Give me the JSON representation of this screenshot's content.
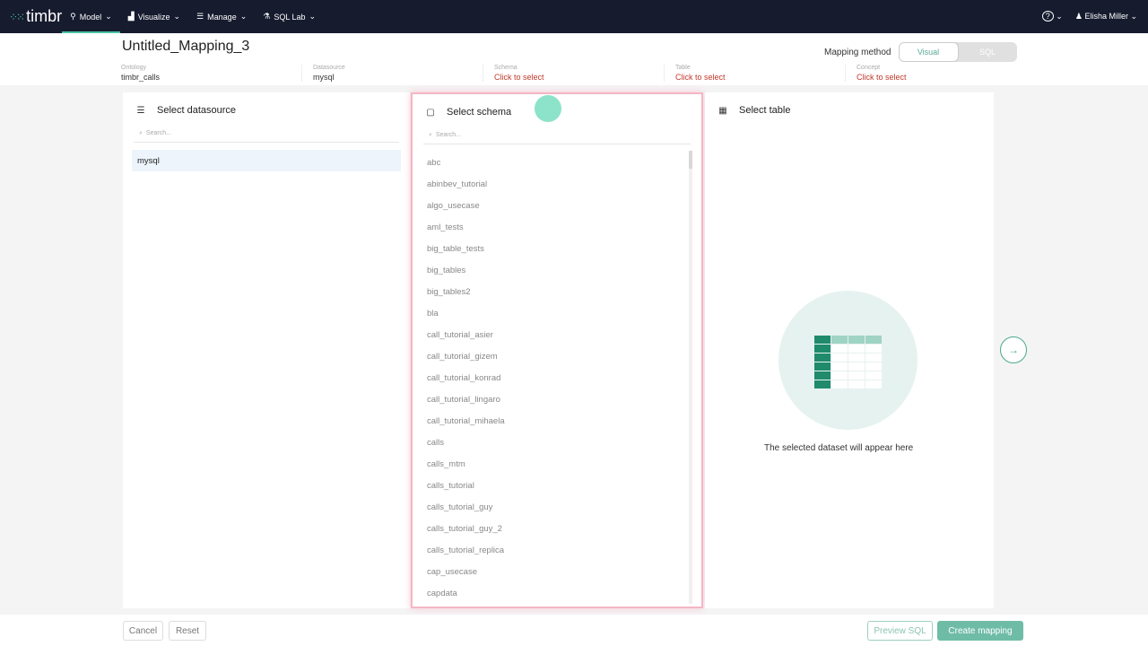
{
  "nav": {
    "logo": "timbr",
    "items": [
      {
        "label": "Model",
        "icon": "bulb-icon"
      },
      {
        "label": "Visualize",
        "icon": "chart-icon"
      },
      {
        "label": "Manage",
        "icon": "database-icon"
      },
      {
        "label": "SQL Lab",
        "icon": "flask-icon"
      }
    ],
    "help": "?",
    "user": "Elisha Miller"
  },
  "header": {
    "title": "Untitled_Mapping_3",
    "mapping_method_label": "Mapping method",
    "methods": [
      "Visual",
      "SQL"
    ],
    "crumbs": [
      {
        "label": "Ontology",
        "value": "timbr_calls"
      },
      {
        "label": "Datasource",
        "value": "mysql"
      },
      {
        "label": "Schema",
        "value": "Click to select"
      },
      {
        "label": "Table",
        "value": "Click to select"
      },
      {
        "label": "Concept",
        "value": "Click to select"
      }
    ]
  },
  "datasource": {
    "title": "Select datasource",
    "search_placeholder": "Search...",
    "items": [
      "mysql"
    ]
  },
  "schema": {
    "title": "Select schema",
    "search_placeholder": "Search...",
    "items": [
      "abc",
      "abinbev_tutorial",
      "algo_usecase",
      "aml_tests",
      "big_table_tests",
      "big_tables",
      "big_tables2",
      "bla",
      "call_tutorial_asier",
      "call_tutorial_gizem",
      "call_tutorial_konrad",
      "call_tutorial_lingaro",
      "call_tutorial_mihaela",
      "calls",
      "calls_mtm",
      "calls_tutorial",
      "calls_tutorial_guy",
      "calls_tutorial_guy_2",
      "calls_tutorial_replica",
      "cap_usecase",
      "capdata"
    ]
  },
  "table": {
    "title": "Select table",
    "empty_text": "The selected dataset will appear here"
  },
  "footer": {
    "cancel": "Cancel",
    "reset": "Reset",
    "preview": "Preview SQL",
    "create": "Create mapping"
  },
  "colors": {
    "accent": "#4cc3a4",
    "nav_bg": "#161b2e",
    "link_red": "#c0392b"
  }
}
